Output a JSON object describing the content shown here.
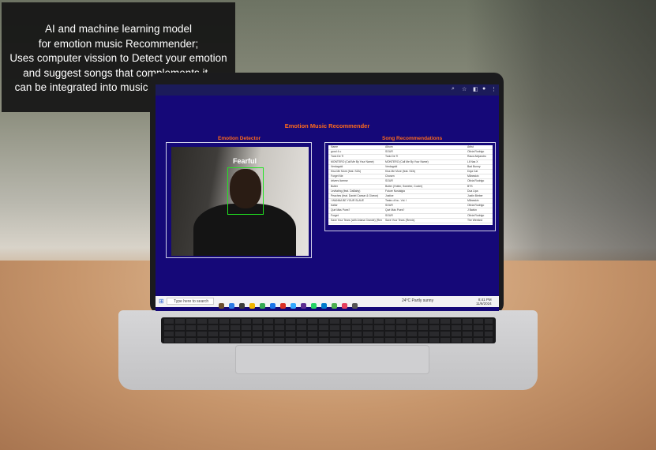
{
  "caption": {
    "lines": [
      "AI and machine learning model",
      "for emotion music Recommender;",
      "Uses computer vission to Detect your emotion",
      "and suggest songs that complements it ,",
      "can be integrated into music apps and more"
    ]
  },
  "app": {
    "title": "Emotion Music Recommender",
    "detector_label": "Emotion Detector",
    "recommendations_label": "Song Recommendations",
    "detected_emotion": "Fearful",
    "columns": [
      "Name",
      "Album",
      "Artist"
    ],
    "rows": [
      [
        "good 4 u",
        "SOUR",
        "Olivia Rodrigo"
      ],
      [
        "Todo De Ti",
        "Todo De Ti",
        "Rauw Alejandro"
      ],
      [
        "MONTERO (Call Me By Your Name)",
        "MONTERO (Call Me By Your Name)",
        "Lil Nas X"
      ],
      [
        "Verdagold",
        "Verdagold",
        "Bad Bunny"
      ],
      [
        "Kiss Me More (feat. SZA)",
        "Kiss Me More (feat. SZA)",
        "Doja Cat"
      ],
      [
        "Forget Me",
        "Chosen",
        "Måneskin"
      ],
      [
        "drivers license",
        "SOUR",
        "Olivia Rodrigo"
      ],
      [
        "Butter",
        "Butter (Hotter, Sweeter, Cooler)",
        "BTS"
      ],
      [
        "Levitating (feat. DaBaby)",
        "Future Nostalgia",
        "Dua Lipa"
      ],
      [
        "Peaches (feat. Daniel Caesar & Giveon)",
        "Justice",
        "Justin Bieber"
      ],
      [
        "I WANNA BE YOUR SLAVE",
        "Teatro d'ira - Vol. I",
        "Måneskin"
      ],
      [
        "traitor",
        "SOUR",
        "Olivia Rodrigo"
      ],
      [
        "Qué Más Pues?",
        "Qué Más Pues?",
        "J Balvin"
      ],
      [
        "Forget",
        "SOUR",
        "Olivia Rodrigo"
      ],
      [
        "Save Your Tears (with Ariana Grande) (Remix)",
        "Save Your Tears (Remix)",
        "The Weeknd"
      ]
    ]
  },
  "taskbar": {
    "search_placeholder": "Type here to search",
    "weather": "24°C  Partly sunny",
    "time": "8:41 PM",
    "date": "11/6/2024"
  },
  "colors": {
    "screen_bg": "#150878",
    "accent_orange": "#ff6a1a",
    "face_box_green": "#21e421"
  }
}
